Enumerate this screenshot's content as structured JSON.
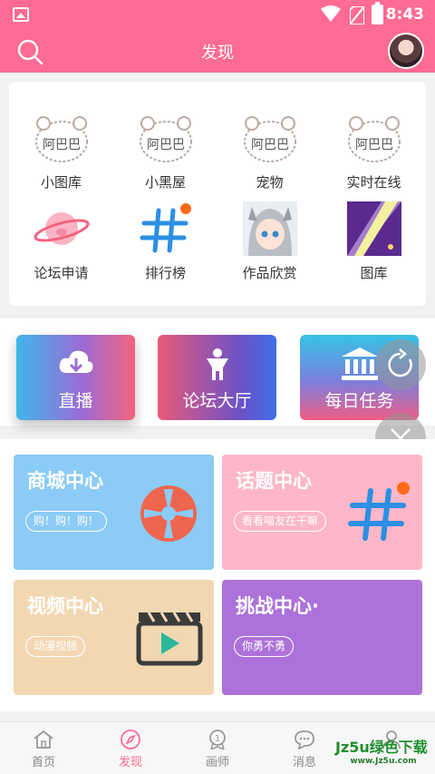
{
  "status_bar": {
    "time": "8:43"
  },
  "header": {
    "title": "发现"
  },
  "grid": [
    {
      "label": "小图库",
      "icon": "pig-sticker-icon"
    },
    {
      "label": "小黑屋",
      "icon": "pig-sticker-icon"
    },
    {
      "label": "宠物",
      "icon": "pig-sticker-icon"
    },
    {
      "label": "实时在线",
      "icon": "pig-sticker-icon"
    },
    {
      "label": "论坛申请",
      "icon": "planet-pig-icon"
    },
    {
      "label": "排行榜",
      "icon": "hashtag-icon"
    },
    {
      "label": "作品欣赏",
      "icon": "anime-girl-image"
    },
    {
      "label": "图库",
      "icon": "purple-streak-image"
    }
  ],
  "mid_buttons": [
    {
      "label": "直播",
      "icon": "cloud-download-icon"
    },
    {
      "label": "论坛大厅",
      "icon": "person-icon"
    },
    {
      "label": "每日任务",
      "icon": "bank-icon"
    }
  ],
  "cards": [
    {
      "title": "商城中心",
      "tag": "购！购！购！",
      "color": "#8ccbf5"
    },
    {
      "title": "话题中心",
      "tag": "看看喵友在干嘛",
      "color": "#fdb7c8"
    },
    {
      "title": "视频中心",
      "tag": "动漫视频",
      "color": "#f2d7b3"
    },
    {
      "title": "挑战中心·",
      "tag": "你勇不勇",
      "color": "#ad72d9"
    }
  ],
  "nav": [
    {
      "label": "首页",
      "active": false
    },
    {
      "label": "发现",
      "active": true
    },
    {
      "label": "画师",
      "active": false
    },
    {
      "label": "消息",
      "active": false
    }
  ],
  "watermark": {
    "line1": "Jz5u绿色下载",
    "line2": "www.Jz5u.com"
  },
  "colors": {
    "primary": "#fe6b93",
    "badge": "#ff6a1a"
  }
}
